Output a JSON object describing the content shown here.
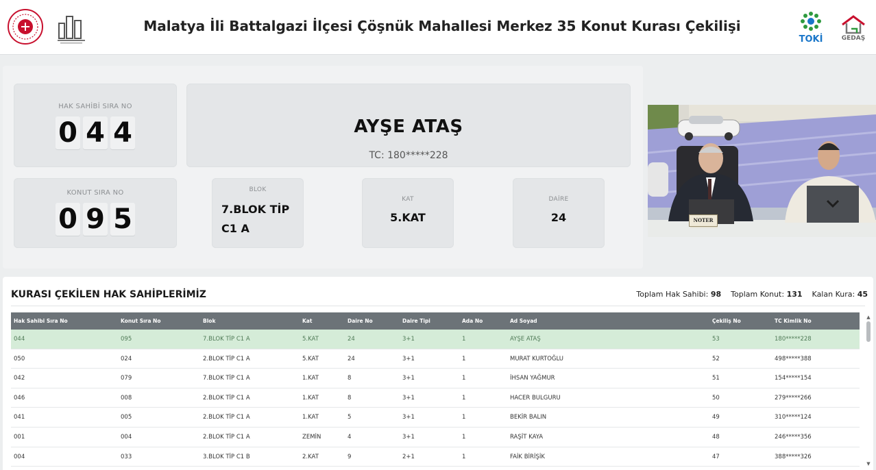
{
  "header": {
    "title": "Malatya İli Battalgazi İlçesi Çöşnük Mahallesi Merkez 35 Konut Kurası Çekilişi",
    "logo_toki": "TOKİ",
    "logo_gedas": "GEDAŞ"
  },
  "draw": {
    "hak_sahibi_label": "HAK SAHİBİ SIRA NO",
    "hak_sahibi_digits": [
      "0",
      "4",
      "4"
    ],
    "name": "AYŞE ATAŞ",
    "tc": "TC: 180*****228",
    "konut_label": "KONUT SIRA NO",
    "konut_digits": [
      "0",
      "9",
      "5"
    ],
    "blok_label": "BLOK",
    "blok_value": "7.BLOK TİP C1 A",
    "kat_label": "KAT",
    "kat_value": "5.KAT",
    "daire_label": "DAİRE",
    "daire_value": "24"
  },
  "video": {
    "noter_sign": "NOTER"
  },
  "list": {
    "title": "KURASI ÇEKİLEN HAK SAHİPLERİMİZ",
    "stats": {
      "hak_sahibi_label": "Toplam Hak Sahibi:",
      "hak_sahibi_value": "98",
      "konut_label": "Toplam Konut:",
      "konut_value": "131",
      "kalan_label": "Kalan Kura:",
      "kalan_value": "45"
    },
    "columns": [
      "Hak Sahibi Sıra No",
      "Konut Sıra No",
      "Blok",
      "Kat",
      "Daire No",
      "Daire Tipi",
      "Ada No",
      "Ad Soyad",
      "Çekiliş No",
      "TC Kimlik No"
    ],
    "rows": [
      [
        "044",
        "095",
        "7.BLOK TİP C1 A",
        "5.KAT",
        "24",
        "3+1",
        "1",
        "AYŞE ATAŞ",
        "53",
        "180*****228"
      ],
      [
        "050",
        "024",
        "2.BLOK TİP C1 A",
        "5.KAT",
        "24",
        "3+1",
        "1",
        "MURAT KURTOĞLU",
        "52",
        "498*****388"
      ],
      [
        "042",
        "079",
        "7.BLOK TİP C1 A",
        "1.KAT",
        "8",
        "3+1",
        "1",
        "İHSAN YAĞMUR",
        "51",
        "154*****154"
      ],
      [
        "046",
        "008",
        "2.BLOK TİP C1 A",
        "1.KAT",
        "8",
        "3+1",
        "1",
        "HACER BULGURU",
        "50",
        "279*****266"
      ],
      [
        "041",
        "005",
        "2.BLOK TİP C1 A",
        "1.KAT",
        "5",
        "3+1",
        "1",
        "BEKİR BALIN",
        "49",
        "310*****124"
      ],
      [
        "001",
        "004",
        "2.BLOK TİP C1 A",
        "ZEMİN",
        "4",
        "3+1",
        "1",
        "RAŞİT KAYA",
        "48",
        "246*****356"
      ],
      [
        "004",
        "033",
        "3.BLOK TİP C1 B",
        "2.KAT",
        "9",
        "2+1",
        "1",
        "FAİK BİRİŞİK",
        "47",
        "388*****326"
      ]
    ]
  }
}
